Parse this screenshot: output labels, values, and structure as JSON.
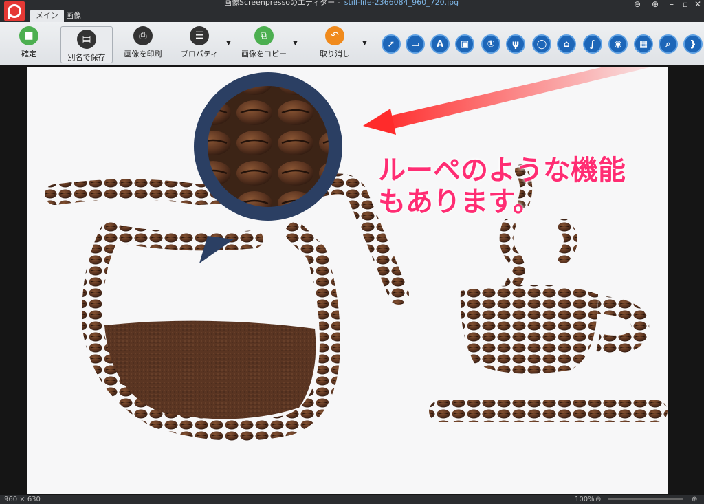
{
  "window": {
    "title": "画像Screenpressoのエディター -",
    "filename": "still-life-2366084_960_720.jpg"
  },
  "tabs": [
    {
      "label": "メイン"
    },
    {
      "label": "画像"
    }
  ],
  "ribbon": {
    "confirm": "確定",
    "save_as": "別名で保存",
    "print": "画像を印刷",
    "properties": "プロパティ",
    "copy": "画像をコピー",
    "undo": "取り消し"
  },
  "tools": [
    {
      "name": "arrow-tool-icon"
    },
    {
      "name": "rectangle-tool-icon"
    },
    {
      "name": "text-tool-icon"
    },
    {
      "name": "callout-tool-icon"
    },
    {
      "name": "step-number-tool-icon"
    },
    {
      "name": "marker-tool-icon"
    },
    {
      "name": "ellipse-tool-icon"
    },
    {
      "name": "polyline-tool-icon"
    },
    {
      "name": "freehand-tool-icon"
    },
    {
      "name": "blur-tool-icon"
    },
    {
      "name": "image-tool-icon"
    },
    {
      "name": "magnifier-tool-icon"
    },
    {
      "name": "bracket-tool-icon"
    }
  ],
  "annotation": {
    "line1": "ルーペのような機能",
    "line2": "もあります。",
    "color": "#ff2d73"
  },
  "status": {
    "dimensions": "960 × 630",
    "zoom": "100%"
  },
  "colors": {
    "accent": "#1d66b8",
    "logo": "#e53935"
  }
}
